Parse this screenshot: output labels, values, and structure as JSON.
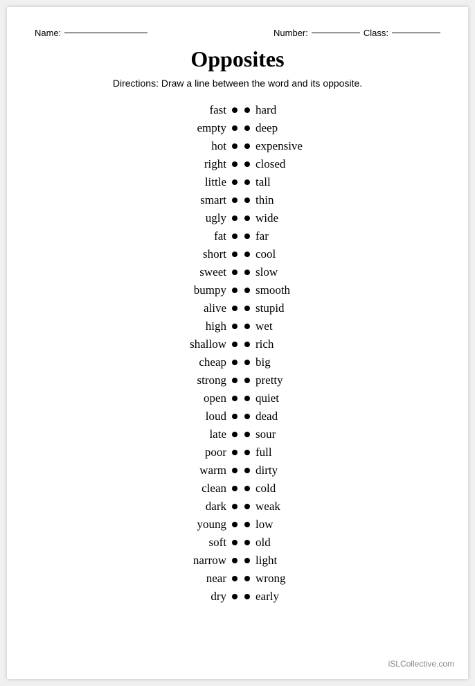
{
  "header": {
    "name_label": "Name:",
    "number_label": "Number:",
    "class_label": "Class:"
  },
  "title": "Opposites",
  "directions": "Directions: Draw a line between the word and its opposite.",
  "left_words": [
    "fast",
    "empty",
    "hot",
    "right",
    "little",
    "smart",
    "ugly",
    "fat",
    "short",
    "sweet",
    "bumpy",
    "alive",
    "high",
    "shallow",
    "cheap",
    "strong",
    "open",
    "loud",
    "late",
    "poor",
    "warm",
    "clean",
    "dark",
    "young",
    "soft",
    "narrow",
    "near",
    "dry"
  ],
  "right_words": [
    "hard",
    "deep",
    "expensive",
    "closed",
    "tall",
    "thin",
    "wide",
    "far",
    "cool",
    "slow",
    "smooth",
    "stupid",
    "wet",
    "rich",
    "big",
    "pretty",
    "quiet",
    "dead",
    "sour",
    "full",
    "dirty",
    "cold",
    "weak",
    "low",
    "old",
    "light",
    "wrong",
    "early"
  ],
  "footer": "iSLCollective.com"
}
